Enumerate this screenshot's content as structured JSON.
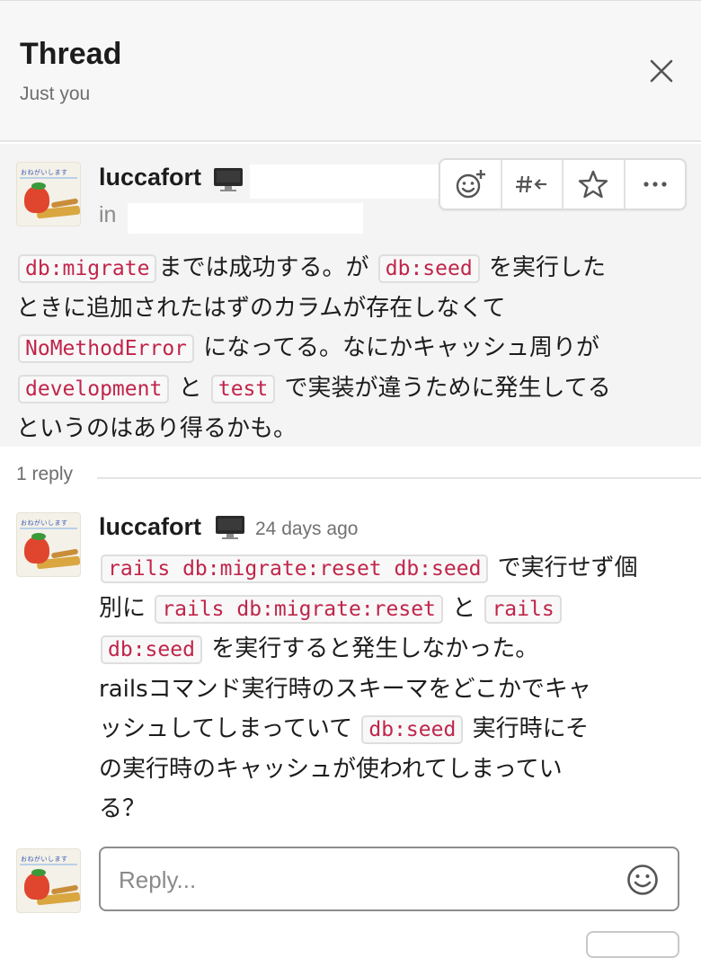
{
  "header": {
    "title": "Thread",
    "subtitle": "Just you",
    "close_icon": "close-icon"
  },
  "parent_message": {
    "author": "luccafort",
    "status_emoji": "desktop-computer-icon",
    "in_label": "in",
    "lines": [
      [
        {
          "code": "db:migrate"
        },
        {
          "text": "までは成功する。が "
        },
        {
          "code": "db:seed"
        },
        {
          "text": " を実行した"
        }
      ],
      [
        {
          "text": "ときに追加されたはずのカラムが存在しなくて"
        }
      ],
      [
        {
          "code": "NoMethodError"
        },
        {
          "text": " になってる。なにかキャッシュ周りが"
        }
      ],
      [
        {
          "code": "development"
        },
        {
          "text": " と "
        },
        {
          "code": "test"
        },
        {
          "text": " で実装が違うために発生してる"
        }
      ],
      [
        {
          "text": "というのはあり得るかも。"
        }
      ]
    ],
    "actions": [
      {
        "name": "add-reaction-button",
        "icon": "add-reaction-icon"
      },
      {
        "name": "share-to-channel-button",
        "icon": "hash-arrow-icon"
      },
      {
        "name": "star-button",
        "icon": "star-icon"
      },
      {
        "name": "more-actions-button",
        "icon": "more-icon"
      }
    ]
  },
  "replies": {
    "count_label": "1 reply",
    "items": [
      {
        "author": "luccafort",
        "status_emoji": "desktop-computer-icon",
        "timestamp": "24 days ago",
        "lines": [
          [
            {
              "code": "rails db:migrate:reset db:seed"
            },
            {
              "text": " で実行せず個"
            }
          ],
          [
            {
              "text": "別に "
            },
            {
              "code": "rails db:migrate:reset"
            },
            {
              "text": " と "
            },
            {
              "code": "rails"
            }
          ],
          [
            {
              "code": "db:seed"
            },
            {
              "text": " を実行すると発生しなかった。"
            }
          ],
          [
            {
              "text": "railsコマンド実行時のスキーマをどこかでキャ"
            }
          ],
          [
            {
              "text": "ッシュしてしまっていて "
            },
            {
              "code": "db:seed"
            },
            {
              "text": " 実行時にそ"
            }
          ],
          [
            {
              "text": "の実行時のキャッシュが使われてしまってい"
            }
          ],
          [
            {
              "text": "る？"
            }
          ]
        ]
      }
    ]
  },
  "composer": {
    "placeholder": "Reply...",
    "emoji_icon": "emoji-icon"
  },
  "avatar": {
    "caption": "おねがいします"
  },
  "colors": {
    "code_text": "#c0254a",
    "header_bg": "#f7f7f7",
    "highlight_bg": "#f4f4f4"
  }
}
